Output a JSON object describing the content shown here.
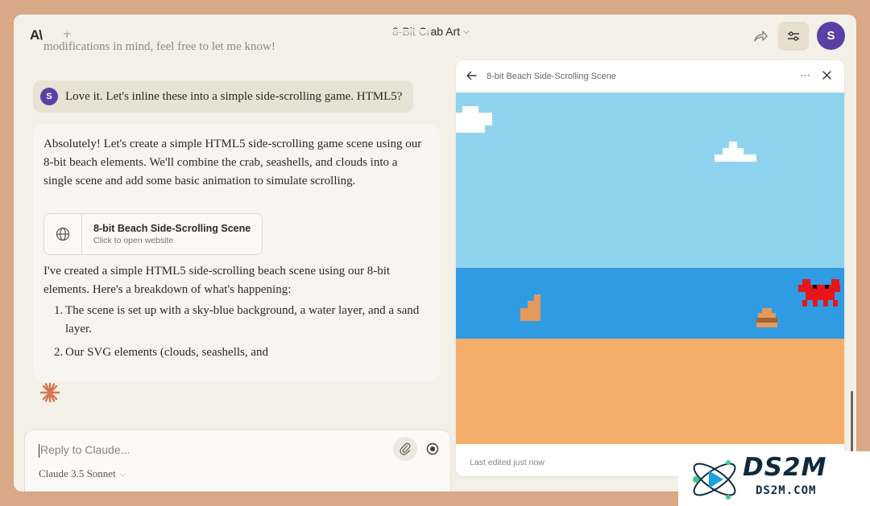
{
  "header": {
    "logo_text": "A\\",
    "new_chat": "+",
    "chat_title": "8-Bit Crab Art",
    "avatar_initial": "S"
  },
  "chat": {
    "faded_text": "modifications in mind, feel free to let me know!",
    "user_message": {
      "avatar_initial": "S",
      "text": "Love it. Let's inline these into a simple side-scrolling game. HTML5?"
    },
    "assistant": {
      "paragraph1": "Absolutely! Let's create a simple HTML5 side-scrolling game scene using our 8-bit beach elements. We'll combine the crab, seashells, and clouds into a single scene and add some basic animation to simulate scrolling.",
      "artifact_card": {
        "title": "8-bit Beach Side-Scrolling Scene",
        "subtitle": "Click to open website"
      },
      "paragraph2": "I've created a simple HTML5 side-scrolling beach scene using our 8-bit elements. Here's a breakdown of what's happening:",
      "list": [
        {
          "num": "1.",
          "text": "The scene is set up with a sky-blue background, a water layer, and a sand layer."
        },
        {
          "num": "2.",
          "text": "Our SVG elements (clouds, seashells, and"
        }
      ]
    }
  },
  "input": {
    "placeholder": "Reply to Claude...",
    "model": "Claude 3.5 Sonnet"
  },
  "panel": {
    "title": "8-bit Beach Side-Scrolling Scene",
    "footer": "Last edited just now"
  },
  "scene_colors": {
    "sky": "#8fd3ef",
    "water": "#2f9be3",
    "sand": "#f4ad6b",
    "crab": "#e8141c",
    "cloud": "#ffffff",
    "shell": "#e39a5b"
  },
  "watermark": {
    "main": "DS2M",
    "sub": "DS2M.COM"
  }
}
